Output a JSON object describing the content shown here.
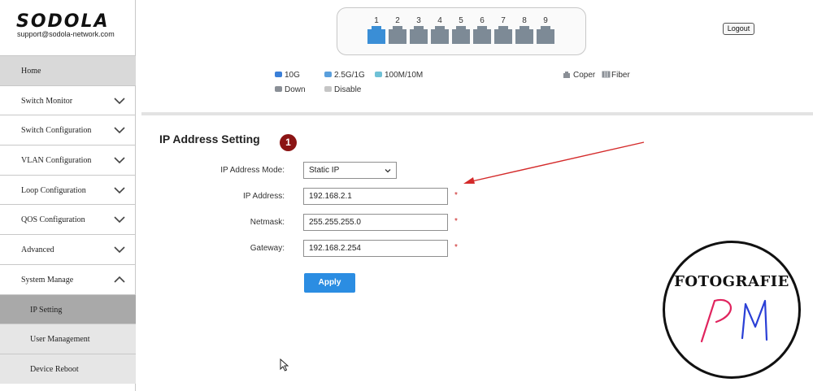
{
  "brand": {
    "logo": "SODOLA",
    "email": "support@sodola-network.com"
  },
  "sidebar": {
    "items": [
      {
        "label": "Home",
        "chevron": "none"
      },
      {
        "label": "Switch Monitor",
        "chevron": "chevron-down-icon"
      },
      {
        "label": "Switch Configuration",
        "chevron": "chevron-down-icon"
      },
      {
        "label": "VLAN Configuration",
        "chevron": "chevron-down-icon"
      },
      {
        "label": "Loop Configuration",
        "chevron": "chevron-down-icon"
      },
      {
        "label": "QOS Configuration",
        "chevron": "chevron-down-icon"
      },
      {
        "label": "Advanced",
        "chevron": "chevron-down-icon"
      },
      {
        "label": "System Manage",
        "chevron": "chevron-up-icon"
      }
    ],
    "submenu": [
      {
        "label": "IP Setting",
        "active": true
      },
      {
        "label": "User Management",
        "active": false
      },
      {
        "label": "Device Reboot",
        "active": false
      }
    ]
  },
  "ports": [
    {
      "number": "1",
      "state": "up"
    },
    {
      "number": "2",
      "state": "down"
    },
    {
      "number": "3",
      "state": "down"
    },
    {
      "number": "4",
      "state": "down"
    },
    {
      "number": "5",
      "state": "down"
    },
    {
      "number": "6",
      "state": "down"
    },
    {
      "number": "7",
      "state": "down"
    },
    {
      "number": "8",
      "state": "down"
    },
    {
      "number": "9",
      "state": "down"
    }
  ],
  "header": {
    "logout_label": "Logout"
  },
  "legend": {
    "speed_10g": "10G",
    "speed_2_5g": "2.5G/1G",
    "speed_100m": "100M/10M",
    "down": "Down",
    "disable": "Disable",
    "coper": "Coper",
    "fiber": "Fiber"
  },
  "colors": {
    "port_up": "#3a8ed6",
    "port_down": "#7d8a96",
    "legend_10g": "#3a7fd8",
    "legend_2_5g": "#5a9fdc",
    "legend_100m": "#6fc1d6",
    "legend_down": "#8a8f96",
    "legend_disable": "#c5c5c5",
    "apply": "#2b8de2",
    "required": "#c91d1d",
    "badge": "#8b1414"
  },
  "form": {
    "title": "IP Address Setting",
    "step_badge": "1",
    "mode_label": "IP Address Mode:",
    "mode_value": "Static IP",
    "ip_label": "IP Address:",
    "ip_value": "192.168.2.1",
    "netmask_label": "Netmask:",
    "netmask_value": "255.255.255.0",
    "gateway_label": "Gateway:",
    "gateway_value": "192.168.2.254",
    "required_mark": "*",
    "apply_label": "Apply"
  },
  "watermark": {
    "title": "FOTOGRAFIE",
    "initials": "PM"
  }
}
